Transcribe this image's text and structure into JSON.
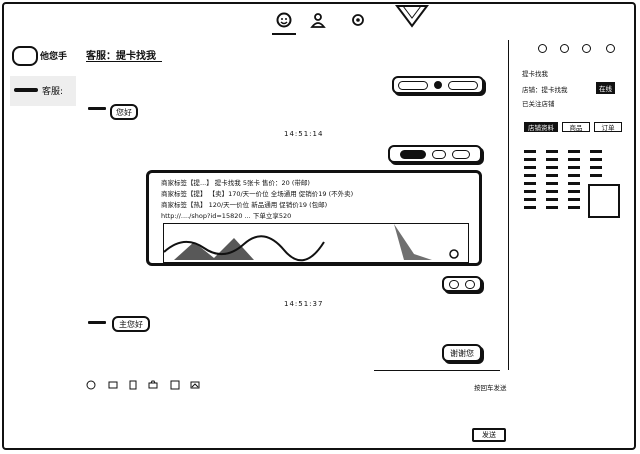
{
  "top_nav": {
    "tabs": [
      "chat-icon",
      "contacts-icon",
      "settings-icon"
    ]
  },
  "sidebar": {
    "brand": "他您手",
    "contacts": [
      {
        "name": "客服:"
      }
    ]
  },
  "chat": {
    "title": "客服：提卡找我",
    "messages": [
      {
        "from": "agent",
        "text": "您好"
      },
      {
        "from": "time",
        "text": "14:51:14"
      },
      {
        "from": "card_time",
        "text": "14:51:37"
      },
      {
        "from": "agent",
        "text": "主您好"
      },
      {
        "from": "user",
        "text": "谢谢您"
      }
    ],
    "card": {
      "lines": [
        "商家标签【提...】 提卡找我 5张卡 售价：20 (带邮)",
        "商家标签【提】 【卖】170/天一价位 全场通用 促销价19 (不外卖)",
        "商家标签【热】 120/天一价位 新品通用 促销价19 (包邮)",
        "http://..../shop?id=15820 ... 下单立享520"
      ]
    },
    "input_toolbar": [
      "emoji-icon",
      "image-icon",
      "file-icon",
      "screenshot-icon",
      "history-icon",
      "more-icon"
    ],
    "send_hint": "按回车发送",
    "send_label": "发送"
  },
  "right_panel": {
    "icons": [
      "call-icon",
      "video-icon",
      "folder-icon",
      "menu-icon"
    ],
    "shop_name": "提卡找我",
    "shop_info": "店铺：提卡找我",
    "shop_status": "在线",
    "shop_sub": "已关注店铺",
    "tabs": [
      "店铺资料",
      "商品",
      "订单"
    ]
  }
}
